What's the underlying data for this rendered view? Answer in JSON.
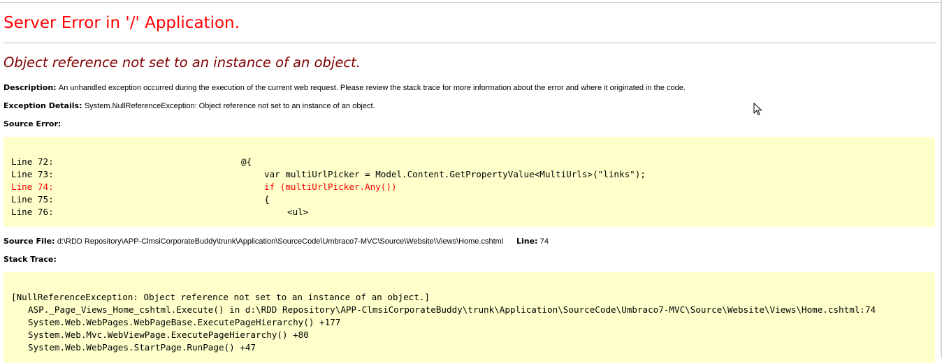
{
  "title": "Server Error in '/' Application.",
  "error_message": "Object reference not set to an instance of an object.",
  "description": {
    "label": "Description:",
    "text": "An unhandled exception occurred during the execution of the current web request. Please review the stack trace for more information about the error and where it originated in the code."
  },
  "exception_details": {
    "label": "Exception Details:",
    "text": "System.NullReferenceException: Object reference not set to an instance of an object."
  },
  "source_error": {
    "label": "Source Error:",
    "lines": [
      {
        "num": "Line 72:",
        "code": "@{"
      },
      {
        "num": "Line 73:",
        "code": "var multiUrlPicker = Model.Content.GetPropertyValue<MultiUrls>(\"links\");"
      },
      {
        "num": "Line 74:",
        "code": "if (multiUrlPicker.Any())"
      },
      {
        "num": "Line 75:",
        "code": "{"
      },
      {
        "num": "Line 76:",
        "code": "<ul>"
      }
    ]
  },
  "source_file": {
    "label": "Source File:",
    "path": "d:\\RDD Repository\\APP-ClmsiCorporateBuddy\\trunk\\Application\\SourceCode\\Umbraco7-MVC\\Source\\Website\\Views\\Home.cshtml",
    "line_label": "Line:",
    "line_value": "74"
  },
  "stack_trace": {
    "label": "Stack Trace:",
    "lines": [
      "[NullReferenceException: Object reference not set to an instance of an object.]",
      "ASP._Page_Views_Home_cshtml.Execute() in d:\\RDD Repository\\APP-ClmsiCorporateBuddy\\trunk\\Application\\SourceCode\\Umbraco7-MVC\\Source\\Website\\Views\\Home.cshtml:74",
      "System.Web.WebPages.WebPageBase.ExecutePageHierarchy() +177",
      "System.Web.Mvc.WebViewPage.ExecutePageHierarchy() +80",
      "System.Web.WebPages.StartPage.RunPage() +47"
    ]
  },
  "colors": {
    "title": "#ff0000",
    "error_message": "#800000",
    "code_background": "#ffffcc",
    "highlight_line": "#ff0000"
  }
}
